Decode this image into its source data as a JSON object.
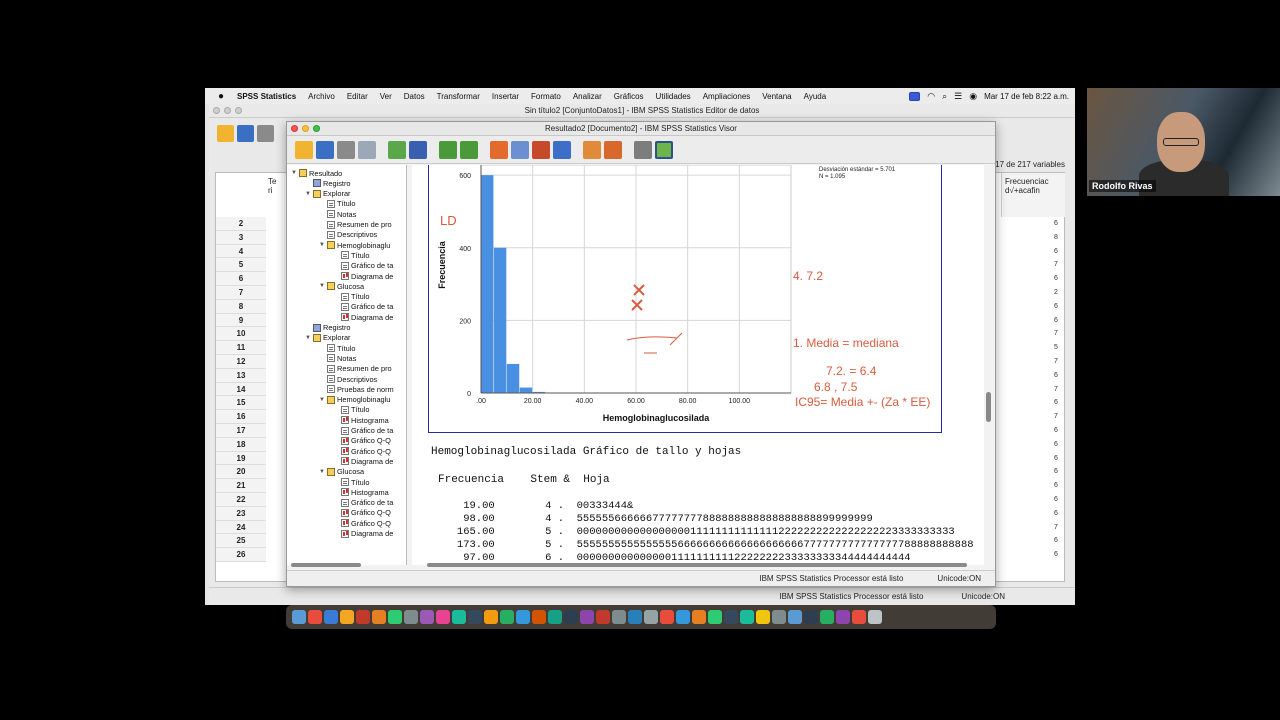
{
  "menubar": {
    "apple": "",
    "app_name": "SPSS Statistics",
    "items": [
      "Archivo",
      "Editar",
      "Ver",
      "Datos",
      "Transformar",
      "Insertar",
      "Formato",
      "Analizar",
      "Gráficos",
      "Utilidades",
      "Ampliaciones",
      "Ventana",
      "Ayuda"
    ],
    "datetime": "Mar 17 de feb  8:22 a.m."
  },
  "editor": {
    "title": "Sin título2 [ConjuntoDatos1] - IBM SPSS Statistics Editor de datos",
    "var_count": "17 de 217 variables",
    "col_left": "Te\nri",
    "col_right": "Frecuenciac\nd√+acafin",
    "rows": [
      "2",
      "3",
      "4",
      "5",
      "6",
      "7",
      "8",
      "9",
      "10",
      "11",
      "12",
      "13",
      "14",
      "15",
      "16",
      "17",
      "18",
      "19",
      "20",
      "21",
      "22",
      "23",
      "24",
      "25",
      "26"
    ],
    "right_vals": [
      "6",
      "8",
      "6",
      "7",
      "6",
      "2",
      "6",
      "6",
      "7",
      "5",
      "7",
      "6",
      "7",
      "6",
      "7",
      "6",
      "6",
      "6",
      "6",
      "6",
      "6",
      "6",
      "7",
      "6",
      "6"
    ],
    "status_processor": "IBM SPSS Statistics Processor está listo",
    "status_unicode": "Unicode:ON"
  },
  "viewer": {
    "title": "Resultado2 [Documento2] - IBM SPSS Statistics Visor",
    "status_processor": "IBM SPSS Statistics Processor está listo",
    "status_unicode": "Unicode:ON",
    "outline": [
      {
        "label": "Resultado",
        "level": 0,
        "icon": "book",
        "twisty": "v"
      },
      {
        "label": "Registro",
        "level": 1,
        "icon": "log",
        "twisty": ""
      },
      {
        "label": "Explorar",
        "level": 1,
        "icon": "book",
        "twisty": "v"
      },
      {
        "label": "Título",
        "level": 2,
        "icon": "page",
        "twisty": ""
      },
      {
        "label": "Notas",
        "level": 2,
        "icon": "page",
        "twisty": ""
      },
      {
        "label": "Resumen de pro",
        "level": 2,
        "icon": "page",
        "twisty": ""
      },
      {
        "label": "Descriptivos",
        "level": 2,
        "icon": "page",
        "twisty": ""
      },
      {
        "label": "Hemoglobinaglu",
        "level": 2,
        "icon": "book",
        "twisty": "v"
      },
      {
        "label": "Título",
        "level": 3,
        "icon": "page",
        "twisty": ""
      },
      {
        "label": "Gráfico de ta",
        "level": 3,
        "icon": "page",
        "twisty": ""
      },
      {
        "label": "Diagrama de",
        "level": 3,
        "icon": "chart",
        "twisty": ""
      },
      {
        "label": "Glucosa",
        "level": 2,
        "icon": "book",
        "twisty": "v"
      },
      {
        "label": "Título",
        "level": 3,
        "icon": "page",
        "twisty": ""
      },
      {
        "label": "Gráfico de ta",
        "level": 3,
        "icon": "page",
        "twisty": ""
      },
      {
        "label": "Diagrama de",
        "level": 3,
        "icon": "chart",
        "twisty": ""
      },
      {
        "label": "Registro",
        "level": 1,
        "icon": "log",
        "twisty": ""
      },
      {
        "label": "Explorar",
        "level": 1,
        "icon": "book",
        "twisty": "v"
      },
      {
        "label": "Título",
        "level": 2,
        "icon": "page",
        "twisty": ""
      },
      {
        "label": "Notas",
        "level": 2,
        "icon": "page",
        "twisty": ""
      },
      {
        "label": "Resumen de pro",
        "level": 2,
        "icon": "page",
        "twisty": ""
      },
      {
        "label": "Descriptivos",
        "level": 2,
        "icon": "page",
        "twisty": ""
      },
      {
        "label": "Pruebas de norm",
        "level": 2,
        "icon": "page",
        "twisty": ""
      },
      {
        "label": "Hemoglobinaglu",
        "level": 2,
        "icon": "book",
        "twisty": "v"
      },
      {
        "label": "Título",
        "level": 3,
        "icon": "page",
        "twisty": ""
      },
      {
        "label": "Histograma",
        "level": 3,
        "icon": "chart",
        "twisty": ""
      },
      {
        "label": "Gráfico de ta",
        "level": 3,
        "icon": "page",
        "twisty": ""
      },
      {
        "label": "Gráfico Q-Q",
        "level": 3,
        "icon": "chart",
        "twisty": ""
      },
      {
        "label": "Gráfico Q-Q",
        "level": 3,
        "icon": "chart",
        "twisty": ""
      },
      {
        "label": "Diagrama de",
        "level": 3,
        "icon": "chart",
        "twisty": ""
      },
      {
        "label": "Glucosa",
        "level": 2,
        "icon": "book",
        "twisty": "v"
      },
      {
        "label": "Título",
        "level": 3,
        "icon": "page",
        "twisty": ""
      },
      {
        "label": "Histograma",
        "level": 3,
        "icon": "chart",
        "twisty": ""
      },
      {
        "label": "Gráfico de ta",
        "level": 3,
        "icon": "page",
        "twisty": ""
      },
      {
        "label": "Gráfico Q-Q",
        "level": 3,
        "icon": "chart",
        "twisty": ""
      },
      {
        "label": "Gráfico Q-Q",
        "level": 3,
        "icon": "chart",
        "twisty": ""
      },
      {
        "label": "Diagrama de",
        "level": 3,
        "icon": "chart",
        "twisty": ""
      }
    ]
  },
  "histogram": {
    "stats_line1": "Media = 7.22",
    "stats_line2": "Desviación estándar = 5.701",
    "stats_line3": "N = 1.095"
  },
  "chart_data": {
    "type": "bar",
    "x": [
      2.5,
      7.5,
      12.5,
      17.5,
      22.5
    ],
    "values": [
      600,
      400,
      80,
      15,
      3
    ],
    "ylabel": "Frecuencia",
    "xlabel": "Hemoglobinaglucosilada",
    "xlim": [
      0,
      120
    ],
    "ylim": [
      0,
      650
    ],
    "yticks": [
      0,
      200,
      400,
      600
    ],
    "xticks": [
      0,
      20,
      40,
      60,
      80,
      100
    ],
    "xtick_labels": [
      ".00",
      "20.00",
      "40.00",
      "60.00",
      "80.00",
      "100.00"
    ],
    "grid": true,
    "bar_color": "#4a90e2"
  },
  "annotations": {
    "ld": "LD",
    "a1": "4.    7.2",
    "a2": "1. Media = mediana",
    "a3": "7.2.  = 6.4",
    "a4": "6.8 , 7.5",
    "a5": "IC95= Media +- (Za * EE)"
  },
  "stemleaf": {
    "title": "Hemoglobinaglucosilada Gráfico de tallo y hojas",
    "header": "Frecuencia    Stem &  Hoja",
    "rows": [
      "    19.00        4 .  00333444&",
      "    98.00        4 .  55555566666677777777888888888888888888899999999",
      "   165.00        5 .  000000000000000000111111111111112222222222222222223333333333",
      "   173.00        5 .  555555555555555566666666666666666666777777777777777788888888888",
      "    97.00        6 .  00000000000000011111111112222222233333333344444444444"
    ]
  },
  "webcam": {
    "name": "Rodolfo Rivas"
  }
}
